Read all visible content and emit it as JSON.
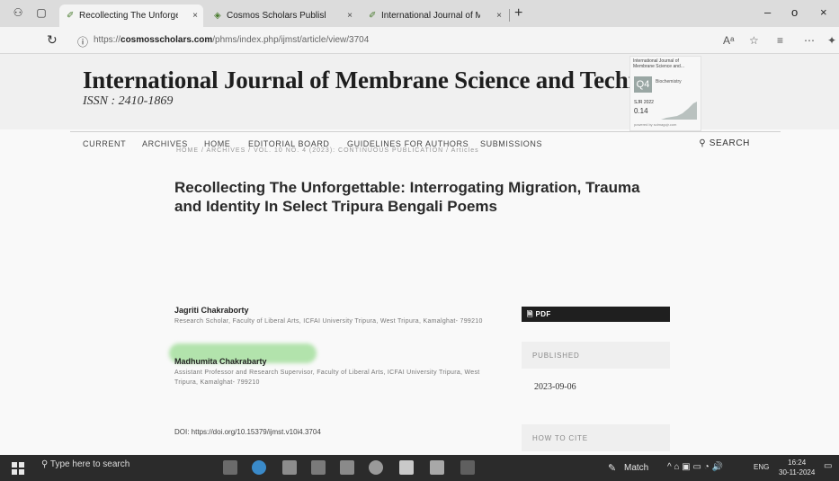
{
  "browser": {
    "tabs": [
      {
        "title": "Recollecting The Unforgettable:"
      },
      {
        "title": "Cosmos Scholars Publishing Hou"
      },
      {
        "title": "International Journal of Membra"
      }
    ],
    "new_tab": "+",
    "close_glyph": "×",
    "url_prefix": "https://",
    "url_domain": "cosmosscholars.com",
    "url_path": "/phms/index.php/ijmst/article/view/3704",
    "read_aloud": "Aᵃ"
  },
  "journal": {
    "title": "International Journal of Membrane Science and Technology",
    "issn": "ISSN : 2410-1869",
    "sjr_widget": {
      "header": "International Journal of Membrane Science and...",
      "quartile": "Q4",
      "category": "Biochemistry",
      "sjr_label": "SJR 2022",
      "sjr_value": "0.14",
      "footer": "powered by scimagojr.com"
    }
  },
  "nav": {
    "items": [
      "CURRENT",
      "ARCHIVES",
      "HOME",
      "EDITORIAL BOARD",
      "GUIDELINES FOR AUTHORS",
      "SUBMISSIONS"
    ],
    "search": "SEARCH"
  },
  "article": {
    "breadcrumb": "HOME / ARCHIVES / VOL. 10 NO. 4 (2023): CONTINUOUS PUBLICATION / Articles",
    "title": "Recollecting The Unforgettable: Interrogating Migration, Trauma and Identity In Select Tripura Bengali Poems",
    "authors": [
      {
        "name": "Jagriti Chakraborty",
        "affiliation": "Research Scholar, Faculty of Liberal Arts, ICFAI University Tripura, West Tripura, Kamalghat- 799210"
      },
      {
        "name": "Madhumita Chakrabarty",
        "affiliation": "Assistant Professor and Research Supervisor, Faculty of Liberal Arts, ICFAI University Tripura, West Tripura, Kamalghat- 799210"
      }
    ],
    "doi": "DOI: https://doi.org/10.15379/ijmst.v10i4.3704",
    "pdf_label": "PDF",
    "published_label": "PUBLISHED",
    "published_date": "2023-09-06",
    "cite_label": "HOW TO CITE"
  },
  "taskbar": {
    "search_placeholder": "Type here to search",
    "weather": "Match",
    "language": "ENG",
    "time": "16:24",
    "date": "30-11-2024"
  },
  "colors": {
    "pdf_button": "#1f1f1f",
    "highlight": "#78d26e",
    "quartile_badge": "#9aa7a4"
  }
}
